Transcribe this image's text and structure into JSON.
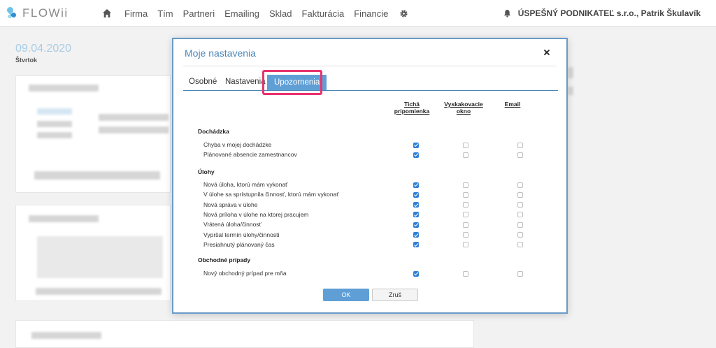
{
  "app": {
    "logo_text": "FLOWii",
    "nav_items": [
      "Firma",
      "Tím",
      "Partneri",
      "Emailing",
      "Sklad",
      "Fakturácia",
      "Financie"
    ],
    "user_name": "ÚSPEŠNÝ PODNIKATEĽ s.r.o., Patrik Škulavík"
  },
  "background": {
    "date": "09.04.2020",
    "weekday": "Štvrtok"
  },
  "modal": {
    "title": "Moje nastavenia",
    "tabs": [
      "Osobné",
      "Nastavenia",
      "Upozornenia"
    ],
    "active_tab": "Upozornenia",
    "columns": {
      "silent_line1": "Tichá",
      "silent_line2": "pripomienka",
      "popup_line1": "Vyskakovacie",
      "popup_line2": "okno",
      "email": "Email"
    },
    "sections": [
      {
        "title": "Dochádzka",
        "rows": [
          {
            "label": "Chyba v mojej dochádzke",
            "silent": true,
            "popup": false,
            "email": false
          },
          {
            "label": "Plánované absencie zamestnancov",
            "silent": true,
            "popup": false,
            "email": false
          }
        ]
      },
      {
        "title": "Úlohy",
        "rows": [
          {
            "label": "Nová úloha, ktorú mám vykonať",
            "silent": true,
            "popup": false,
            "email": false
          },
          {
            "label": "V úlohe sa sprístupnila činnosť, ktorú mám vykonať",
            "silent": true,
            "popup": false,
            "email": false
          },
          {
            "label": "Nová správa v úlohe",
            "silent": true,
            "popup": false,
            "email": false
          },
          {
            "label": "Nová príloha v úlohe na ktorej pracujem",
            "silent": true,
            "popup": false,
            "email": false
          },
          {
            "label": "Vrátená úloha/činnosť",
            "silent": true,
            "popup": false,
            "email": false
          },
          {
            "label": "Vypršal termín úlohy/činnosti",
            "silent": true,
            "popup": false,
            "email": false
          },
          {
            "label": "Presiahnutý plánovaný čas",
            "silent": true,
            "popup": false,
            "email": false
          }
        ]
      },
      {
        "title": "Obchodné prípady",
        "rows": [
          {
            "label": "Nový obchodný prípad pre mňa",
            "silent": true,
            "popup": false,
            "email": false
          }
        ]
      }
    ],
    "ok_label": "OK",
    "cancel_label": "Zruš"
  },
  "colors": {
    "accent": "#5f9fd6",
    "highlight": "#e8336d",
    "checkbox_on": "#2f7fd8"
  }
}
